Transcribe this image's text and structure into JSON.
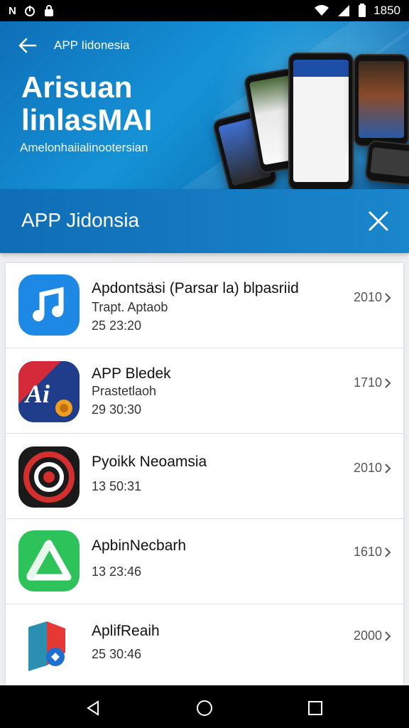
{
  "status_bar": {
    "left_icons": [
      "nfc-icon",
      "power-icon",
      "lock-icon"
    ],
    "left_text": "N",
    "time": "1850",
    "right_icons": [
      "wifi-icon",
      "signal-icon",
      "battery-icon"
    ]
  },
  "banner": {
    "crumb": "APP Iidonesia",
    "title": "Arisuan linlasMAI",
    "subtitle": "Amelonhaiialinootersian"
  },
  "toolbar": {
    "title": "APP Jidonsia"
  },
  "apps": [
    {
      "title": "Apdontsäsi (Parsar la) blpasriid",
      "subtitle": "Trapt. Aptaob",
      "time": "25 23:20",
      "count": "2010",
      "icon": "music-note-icon",
      "color": "#1e88e5"
    },
    {
      "title": "APP Bledek",
      "subtitle": "Prastetlaoh",
      "time": "29 30:30",
      "count": "1710",
      "icon": "ai-logo-icon",
      "color": "#1f3d8a"
    },
    {
      "title": "Pyoikk Neoamsia",
      "subtitle": "",
      "time": "13 50:31",
      "count": "2010",
      "icon": "target-icon",
      "color": "#1a1a1a"
    },
    {
      "title": "ApbinNecbarh",
      "subtitle": "",
      "time": "13 23:46",
      "count": "1610",
      "icon": "triangle-icon",
      "color": "#2ec25a"
    },
    {
      "title": "AplifReaih",
      "subtitle": "",
      "time": "25 30:46",
      "count": "2000",
      "icon": "map-pin-icon",
      "color": "#ffffff"
    }
  ],
  "nav": {
    "back": "back-triangle-icon",
    "home": "home-circle-icon",
    "recents": "recents-square-icon"
  }
}
